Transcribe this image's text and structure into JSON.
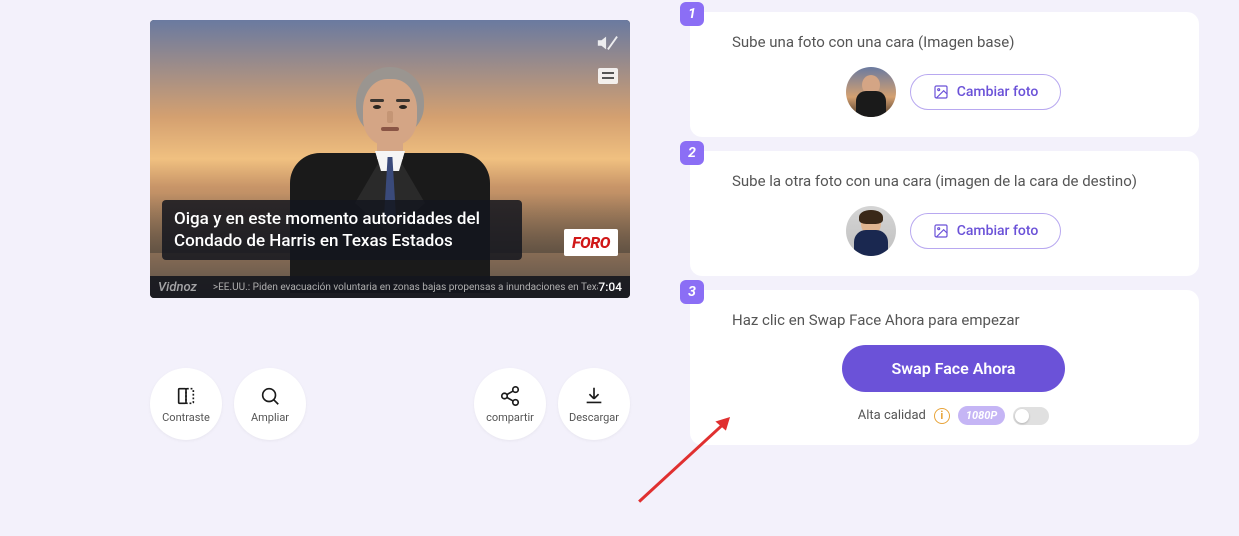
{
  "video": {
    "subtitle": "Oiga y en este momento autoridades del Condado de Harris en Texas Estados",
    "badge": "FORO",
    "watermark": "Vidnoz",
    "ticker": ">EE.UU.: Piden evacuación voluntaria en zonas bajas propensas a inundaciones en Texas",
    "duration": "7:04"
  },
  "tools": {
    "contrast": "Contraste",
    "zoom": "Ampliar",
    "share": "compartir",
    "download": "Descargar"
  },
  "steps": {
    "s1": {
      "num": "1",
      "title": "Sube una foto con una cara (Imagen base)",
      "btn": "Cambiar foto"
    },
    "s2": {
      "num": "2",
      "title": "Sube la otra foto con una cara (imagen de la cara de destino)",
      "btn": "Cambiar foto"
    },
    "s3": {
      "num": "3",
      "title": "Haz clic en Swap Face Ahora para empezar",
      "swap": "Swap Face Ahora",
      "quality_label": "Alta calidad",
      "quality_badge": "1080P"
    }
  }
}
